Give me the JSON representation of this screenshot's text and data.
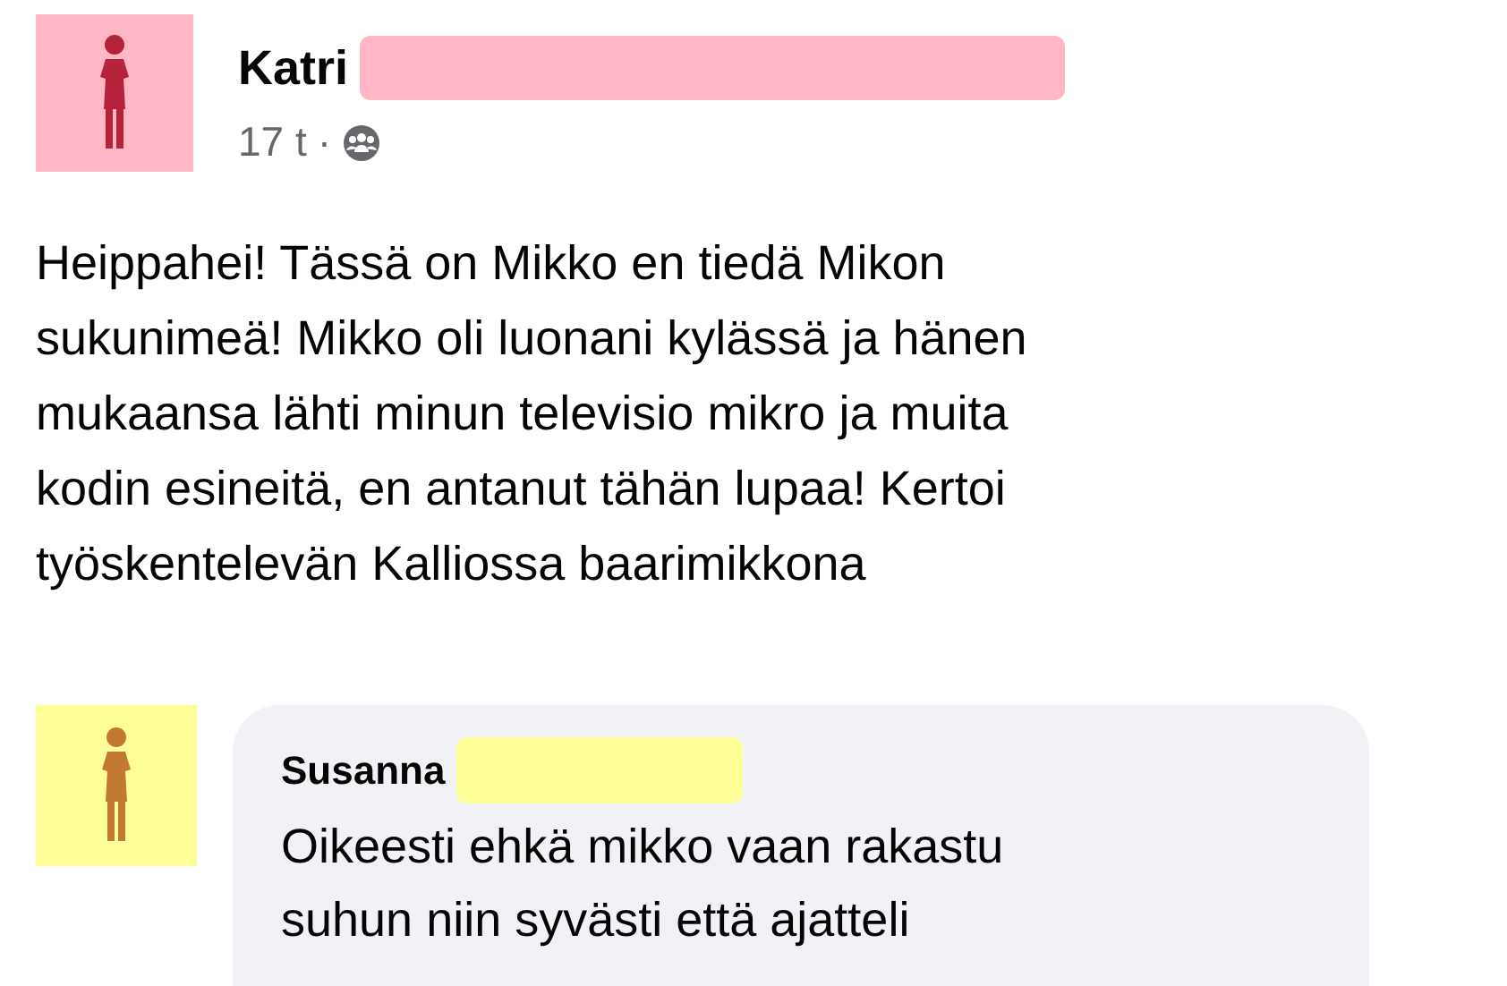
{
  "post": {
    "author": "Katri",
    "time": "17 t",
    "separator": "·",
    "text_lines": [
      "Heippahei! Tässä on Mikko en tiedä Mikon",
      "sukunimeä! Mikko oli luonani kylässä ja hänen",
      "mukaansa lähti minun televisio mikro ja muita",
      "kodin esineitä, en antanut tähän lupaa! Kertoi",
      "työskentelevän Kalliossa baarimikkona"
    ]
  },
  "comments": [
    {
      "author": "Susanna",
      "text_lines": [
        "Oikeesti ehkä mikko vaan rakastu",
        "suhun niin syvästi että ajatteli"
      ]
    }
  ]
}
